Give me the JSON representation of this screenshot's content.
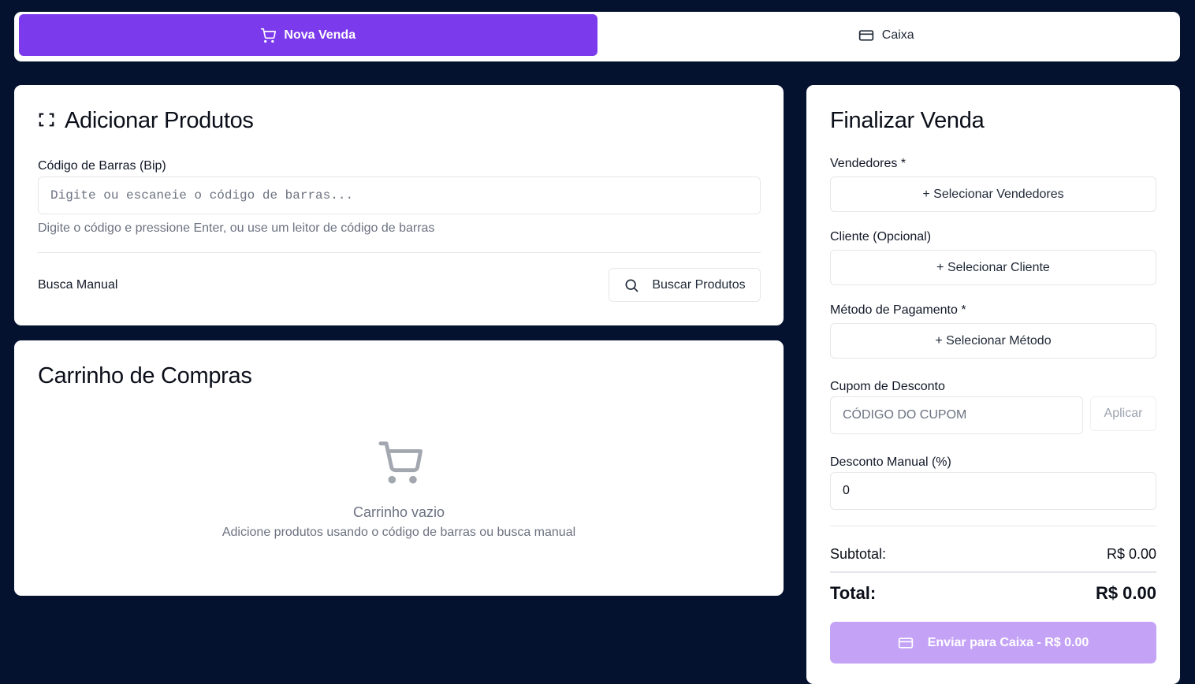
{
  "tabs": [
    {
      "label": "Nova Venda",
      "icon": "cart-icon",
      "active": true
    },
    {
      "label": "Caixa",
      "icon": "credit-card-icon",
      "active": false
    }
  ],
  "add_products": {
    "title": "Adicionar Produtos",
    "barcode_label": "Código de Barras (Bip)",
    "barcode_placeholder": "Digite ou escaneie o código de barras...",
    "barcode_hint": "Digite o código e pressione Enter, ou use um leitor de código de barras",
    "manual_label": "Busca Manual",
    "search_button": "Buscar Produtos"
  },
  "cart": {
    "title": "Carrinho de Compras",
    "empty_title": "Carrinho vazio",
    "empty_hint": "Adicione produtos usando o código de barras ou busca manual"
  },
  "checkout": {
    "title": "Finalizar Venda",
    "sellers_label": "Vendedores *",
    "sellers_button": "+ Selecionar Vendedores",
    "client_label": "Cliente (Opcional)",
    "client_button": "+ Selecionar Cliente",
    "payment_label": "Método de Pagamento *",
    "payment_button": "+ Selecionar Método",
    "coupon_label": "Cupom de Desconto",
    "coupon_placeholder": "CÓDIGO DO CUPOM",
    "coupon_apply": "Aplicar",
    "manual_discount_label": "Desconto Manual (%)",
    "manual_discount_value": "0",
    "subtotal_label": "Subtotal:",
    "subtotal_value": "R$ 0.00",
    "total_label": "Total:",
    "total_value": "R$ 0.00",
    "submit_button": "Enviar para Caixa - R$ 0.00"
  },
  "colors": {
    "background": "#04122f",
    "accent": "#7c3aed",
    "accent_disabled": "#c4a3f7"
  }
}
